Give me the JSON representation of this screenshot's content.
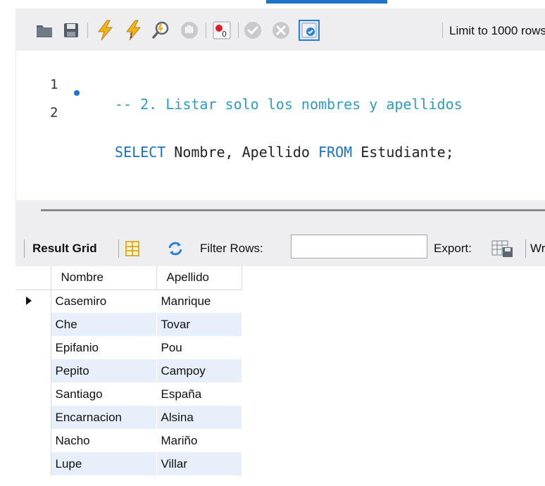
{
  "toolbar": {
    "limit_label": "Limit to 1000 rows",
    "icons": [
      "open-folder-icon",
      "save-icon",
      "execute-icon",
      "execute-current-icon",
      "explain-icon",
      "stop-icon",
      "toggle-error-icon",
      "commit-icon",
      "rollback-icon",
      "autocommit-icon"
    ]
  },
  "editor": {
    "lines": [
      {
        "number": "1",
        "comment": "-- 2. Listar solo los nombres y apellidos"
      },
      {
        "number": "2",
        "kw1": "SELECT",
        "cols": " Nombre, Apellido ",
        "kw2": "FROM",
        "table": " Estudiante;"
      }
    ]
  },
  "result_bar": {
    "result_grid_label": "Result Grid",
    "filter_label": "Filter Rows:",
    "filter_value": "",
    "export_label": "Export:",
    "wrap_label": "Wrap Cell Content:"
  },
  "grid": {
    "columns": [
      "Nombre",
      "Apellido"
    ],
    "rows": [
      [
        "Casemiro",
        "Manrique"
      ],
      [
        "Che",
        "Tovar"
      ],
      [
        "Epifanio",
        "Pou"
      ],
      [
        "Pepito",
        "Campoy"
      ],
      [
        "Santiago",
        "España"
      ],
      [
        "Encarnacion",
        "Alsina"
      ],
      [
        "Nacho",
        "Mariño"
      ],
      [
        "Lupe",
        "Villar"
      ]
    ]
  },
  "colors": {
    "accent": "#1f74c9",
    "keyword": "#1b72c2",
    "comment": "#2f9bc4",
    "row_alt": "#e6effa"
  }
}
